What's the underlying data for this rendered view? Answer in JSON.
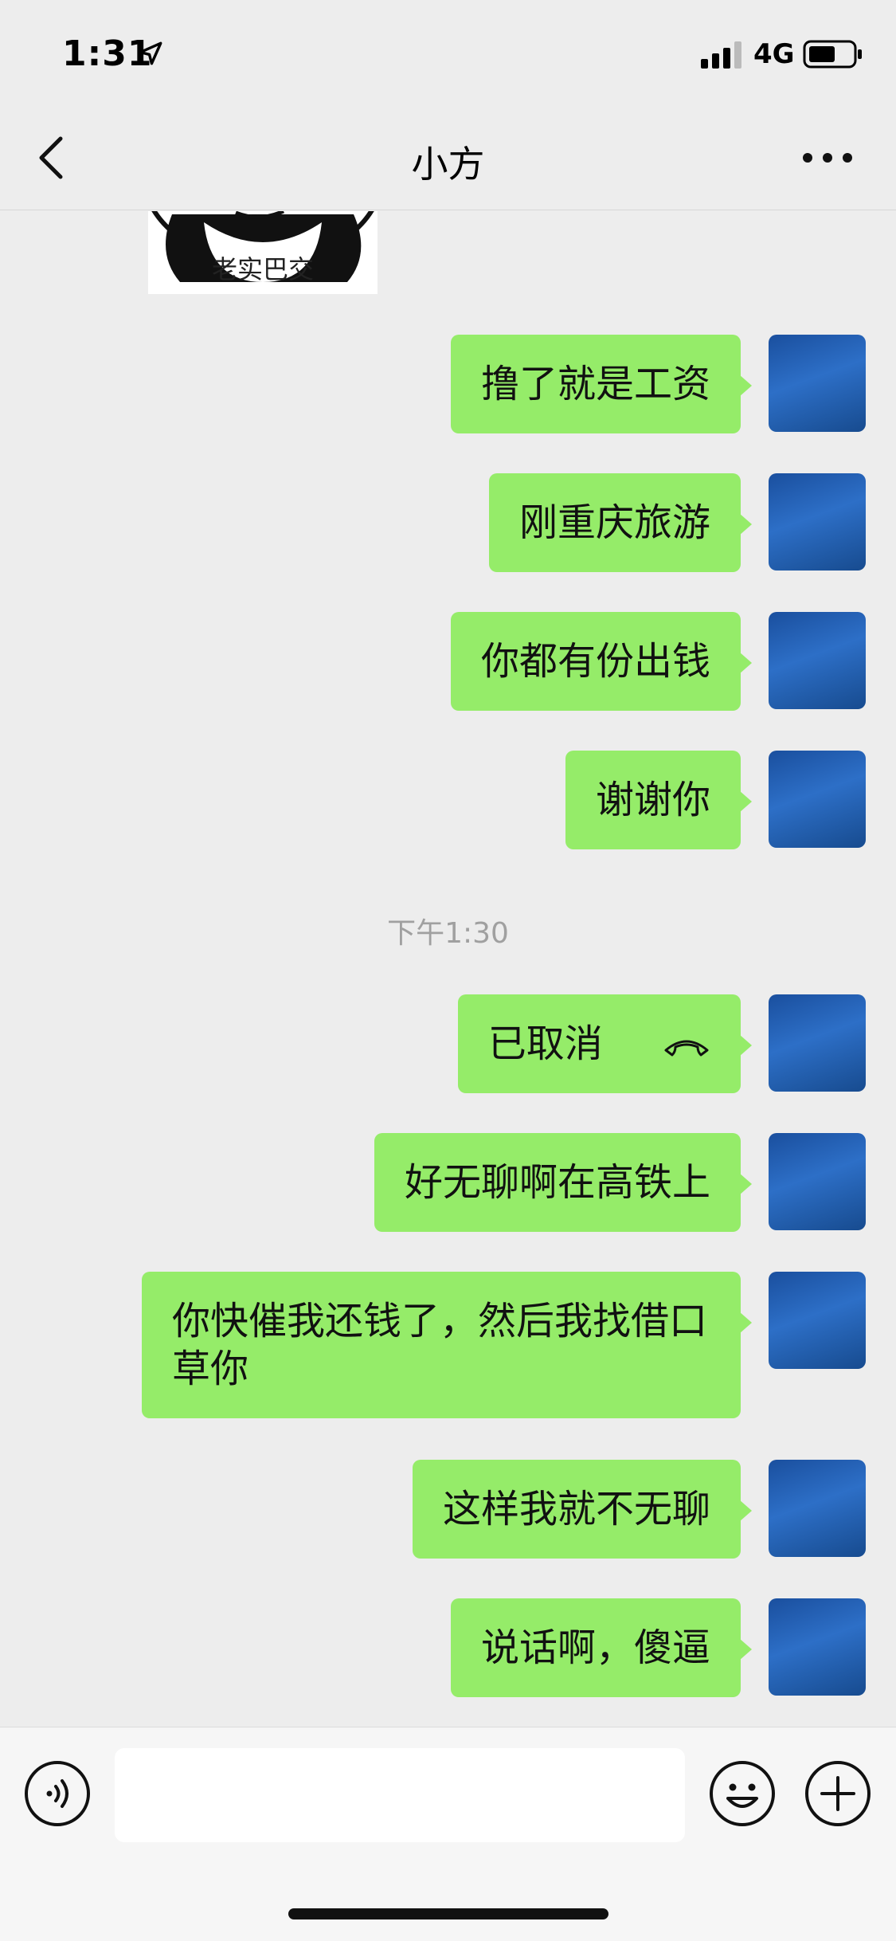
{
  "status_bar": {
    "time": "1:31",
    "network": "4G"
  },
  "nav": {
    "title": "小方"
  },
  "sticker": {
    "caption": "老实巴交"
  },
  "messages": [
    {
      "text": "撸了就是工资"
    },
    {
      "text": "刚重庆旅游"
    },
    {
      "text": "你都有份出钱"
    },
    {
      "text": "谢谢你"
    },
    {
      "text": "已取消"
    },
    {
      "text": "好无聊啊在高铁上"
    },
    {
      "text": "你快催我还钱了，然后我找借口草你"
    },
    {
      "text": "这样我就不无聊"
    },
    {
      "text": "说话啊，傻逼"
    }
  ],
  "time_separator": "下午1:30",
  "input": {
    "value": ""
  },
  "colors": {
    "bubble_green": "#95ec69",
    "background": "#ededed"
  }
}
